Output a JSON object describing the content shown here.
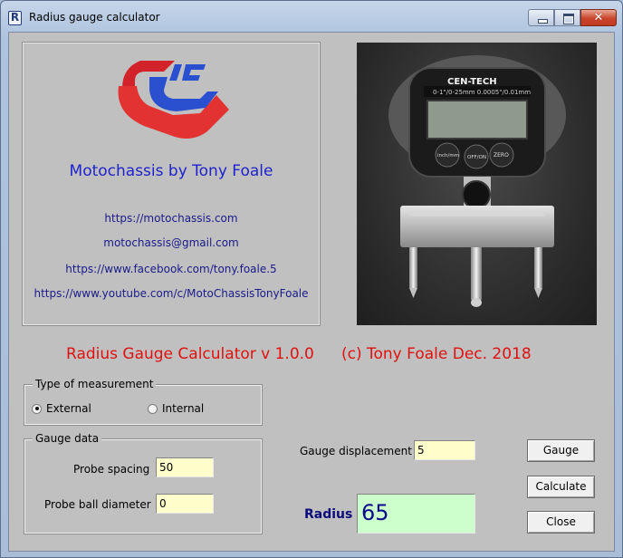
{
  "window": {
    "title": "Radius gauge calculator",
    "icon_letter": "R",
    "close_glyph": "✕"
  },
  "info": {
    "brand": "Motochassis by Tony Foale",
    "links": [
      "https://motochassis.com",
      "motochassis@gmail.com",
      "https://www.facebook.com/tony.foale.5",
      "https://www.youtube.com/c/MotoChassisTonyFoale"
    ]
  },
  "photo": {
    "brand_text": "CEN-TECH",
    "button_labels": [
      "inch/mm",
      "OFF/ON",
      "ZERO"
    ]
  },
  "header": {
    "app_title": "Radius Gauge Calculator  v 1.0.0",
    "copyright": "(c) Tony Foale Dec. 2018"
  },
  "measurement": {
    "legend": "Type of measurement",
    "options": [
      "External",
      "Internal"
    ],
    "selected": "External"
  },
  "gauge_data": {
    "legend": "Gauge data",
    "probe_spacing_label": "Probe spacing",
    "probe_spacing_value": "50",
    "probe_ball_diameter_label": "Probe ball diameter",
    "probe_ball_diameter_value": "0"
  },
  "displacement": {
    "label": "Gauge displacement",
    "value": "5"
  },
  "result": {
    "label": "Radius",
    "value": "65"
  },
  "buttons": {
    "gauge": "Gauge",
    "calculate": "Calculate",
    "close": "Close"
  },
  "colors": {
    "accent_red": "#e01010",
    "brand_blue": "#1e22cc",
    "input_yellow": "#ffffcc",
    "result_green": "#ccffcc"
  }
}
